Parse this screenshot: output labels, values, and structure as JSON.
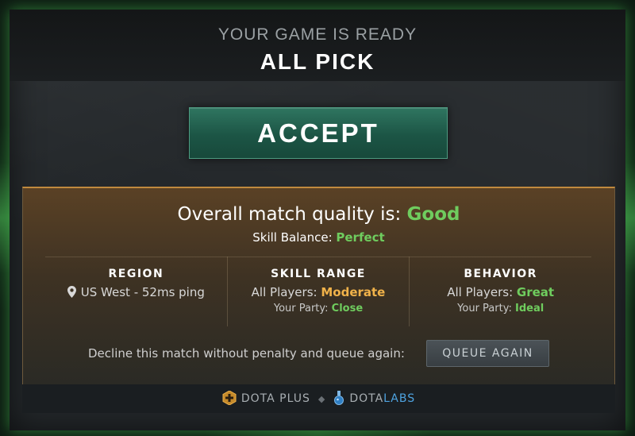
{
  "header": {
    "subtitle": "YOUR GAME IS READY",
    "mode": "ALL PICK"
  },
  "accept_label": "ACCEPT",
  "quality": {
    "title_prefix": "Overall match quality is: ",
    "title_value": "Good",
    "skill_balance_label": "Skill Balance: ",
    "skill_balance_value": "Perfect"
  },
  "stats": {
    "region": {
      "label": "REGION",
      "value": "US West - 52ms ping"
    },
    "skill_range": {
      "label": "SKILL RANGE",
      "all_players_label": "All Players: ",
      "all_players_value": "Moderate",
      "party_label": "Your Party: ",
      "party_value": "Close"
    },
    "behavior": {
      "label": "BEHAVIOR",
      "all_players_label": "All Players: ",
      "all_players_value": "Great",
      "party_label": "Your Party: ",
      "party_value": "Ideal"
    }
  },
  "decline": {
    "text": "Decline this match without penalty and queue again:",
    "button_label": "QUEUE AGAIN"
  },
  "footer": {
    "dota_plus": "DOTA PLUS",
    "separator": "◆",
    "dotalabs_dota": "DOTA",
    "dotalabs_labs": "LABS"
  },
  "icons": {
    "region": "map-pin-icon",
    "dota_plus": "dota-plus-icon",
    "dotalabs": "flask-icon"
  },
  "colors": {
    "good": "#6fcc5e",
    "moderate": "#f0b24a",
    "accept": "#1c5545",
    "labs": "#4ea3e0"
  }
}
